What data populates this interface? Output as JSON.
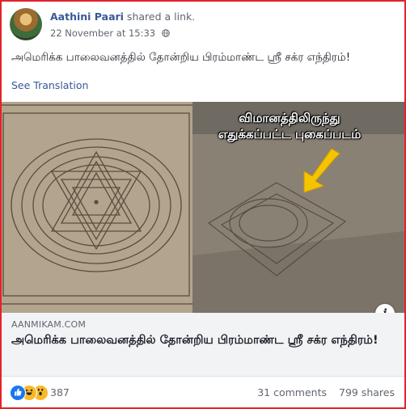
{
  "post": {
    "author": "Aathini Paari",
    "action": " shared a link.",
    "timestamp": "22 November at 15:33",
    "text": "அமெரிக்க பாலைவனத்தில் தோன்றிய பிரம்மாண்ட ஸ்ரீ சக்ர எந்திரம்!",
    "see_translation": "See Translation"
  },
  "link": {
    "image_caption_line1": "விமானத்திலிருந்து",
    "image_caption_line2": "எதுக்கப்பட்ட புகைப்படம்",
    "domain": "AANMIKAM.COM",
    "title": "அமெரிக்க பாலைவனத்தில் தோன்றிய பிரம்மாண்ட ஸ்ரீ சக்ர எந்திரம்!",
    "info_glyph": "i"
  },
  "engagement": {
    "reactions": [
      "like-icon",
      "haha-icon",
      "wow-icon"
    ],
    "reaction_count": "387",
    "comments": "31 comments",
    "shares": "799 shares"
  },
  "colors": {
    "frame_border": "#e4222a",
    "link_blue": "#385898",
    "like_blue": "#1877f2",
    "emoji_yellow": "#f7b928",
    "arrow_yellow": "#f5c400"
  }
}
